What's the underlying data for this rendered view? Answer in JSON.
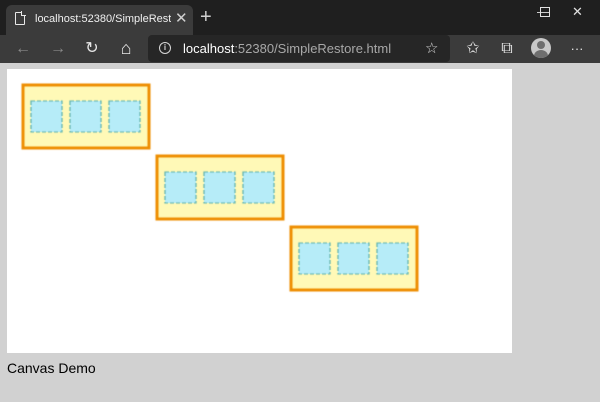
{
  "browser": {
    "tab_title": "localhost:52380/SimpleRestore.ht",
    "tab_close": "✕",
    "new_tab": "+",
    "window_controls": {
      "minimize": "—",
      "maximize": "☐",
      "close": "✕"
    },
    "toolbar": {
      "back_icon": "←",
      "forward_icon": "→",
      "refresh_icon": "↻",
      "home_icon": "⌂",
      "info_icon": "i",
      "url_host": "localhost",
      "url_rest": ":52380/SimpleRestore.html",
      "favorite_icon": "☆",
      "favorites_icon": "✩",
      "collections_icon": "⧉",
      "more_icon": "···"
    }
  },
  "page": {
    "caption": "Canvas Demo",
    "colors": {
      "frame_fill": "#fff9b7",
      "frame_stroke": "#ee8d00",
      "square_fill": "#b6ecf8",
      "square_stroke": "#5bb0ad"
    }
  }
}
